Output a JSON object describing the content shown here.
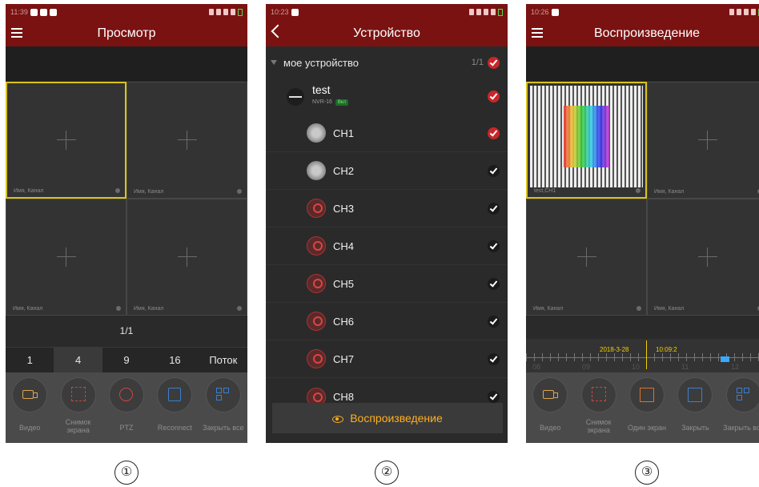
{
  "screens": [
    {
      "status_time": "11:39",
      "title": "Просмотр",
      "cell_label": "Имя, Канал",
      "page_indicator": "1/1",
      "split_options": [
        "1",
        "4",
        "9",
        "16",
        "Поток"
      ],
      "active_split": "4",
      "tools": [
        {
          "label": "Видео",
          "icon": "video-camera-icon"
        },
        {
          "label": "Снимок экрана",
          "icon": "screenshot-icon"
        },
        {
          "label": "PTZ",
          "icon": "ptz-icon"
        },
        {
          "label": "Reconnect",
          "icon": "reconnect-icon"
        },
        {
          "label": "Закрыть все",
          "icon": "close-all-icon"
        }
      ],
      "marker": "①"
    },
    {
      "status_time": "10:23",
      "title": "Устройство",
      "root": {
        "label": "мое устройство",
        "count": "1/1"
      },
      "device": {
        "name": "test",
        "model": "NVR-16",
        "status": "Вкл"
      },
      "channels": [
        "CH1",
        "CH2",
        "CH3",
        "CH4",
        "CH5",
        "CH6",
        "CH7",
        "CH8"
      ],
      "play_button": "Воспроизведение",
      "marker": "②"
    },
    {
      "status_time": "10:26",
      "title": "Воспроизведение",
      "first_cell_label": "test,CH1",
      "cell_label": "Имя, Канал",
      "timeline": {
        "date": "2018-3-28",
        "time": "10:09:2",
        "hours": [
          "08",
          "09",
          "10",
          "11",
          "12"
        ]
      },
      "tools": [
        {
          "label": "Видео",
          "icon": "video-camera-icon"
        },
        {
          "label": "Снимок экрана",
          "icon": "screenshot-icon"
        },
        {
          "label": "Один экран",
          "icon": "single-screen-icon"
        },
        {
          "label": "Закрыть",
          "icon": "close-icon"
        },
        {
          "label": "Закрыть все",
          "icon": "close-all-icon"
        }
      ],
      "marker": "③"
    }
  ]
}
